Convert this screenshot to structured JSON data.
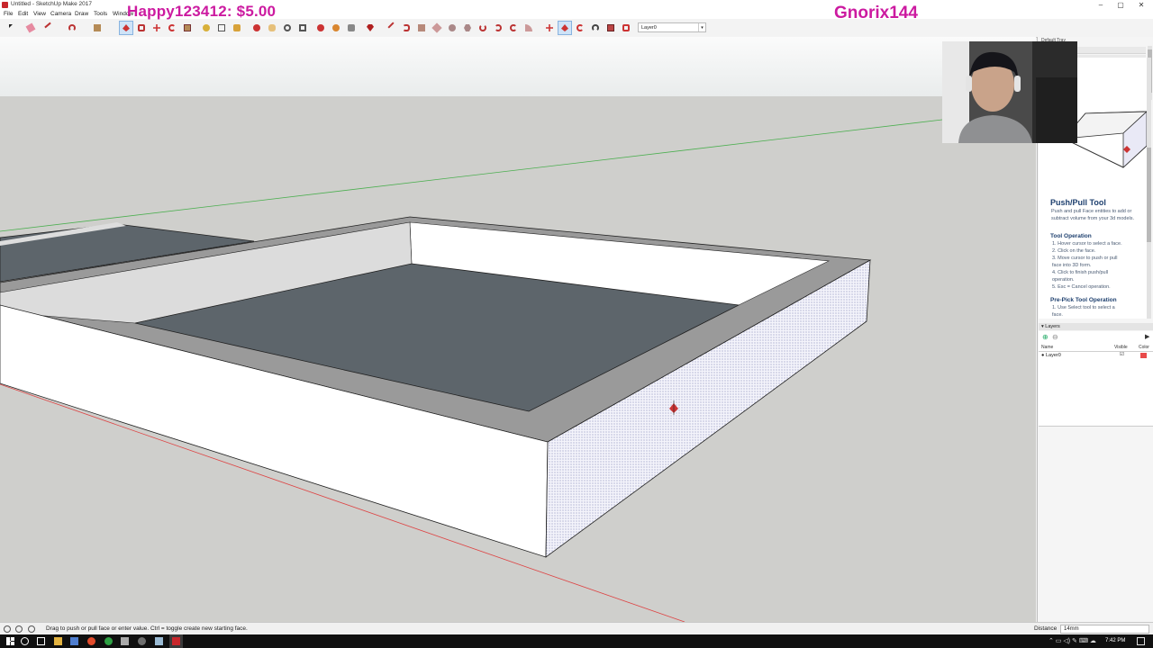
{
  "window": {
    "title": "Untitled - SketchUp Make 2017",
    "controls": {
      "minimize": "–",
      "maximize": "▢",
      "close": "✕"
    }
  },
  "menu": [
    "File",
    "Edit",
    "View",
    "Camera",
    "Draw",
    "Tools",
    "Window"
  ],
  "toolbar": {
    "layer_dropdown": "Layer0",
    "icons": [
      "select-icon",
      "eraser-icon",
      "line-icon",
      "arc-icon",
      "rectangle-icon",
      "push-pull-icon",
      "offset-icon",
      "move-icon",
      "rotate-icon",
      "scale-icon",
      "tape-measure-icon",
      "text-icon",
      "paint-bucket-icon",
      "orbit-icon",
      "pan-icon",
      "zoom-icon",
      "zoom-extents-icon"
    ],
    "active": "push-pull-icon"
  },
  "stream_overlay": {
    "donation": "Happy123412: $5.00",
    "username": "Gnorix144"
  },
  "tray": {
    "title": "Default Tray",
    "instructor": {
      "tool_name": "Push/Pull Tool",
      "description": "Push and pull Face entities to add or subtract volume from your 3d models.",
      "operation_heading": "Tool Operation",
      "operation_steps": [
        "1.  Hover cursor to select a face.",
        "2.  Click on the face.",
        "3.  Move cursor to push or pull",
        "     face into 3D form.",
        "4.  Click to finish push/pull",
        "     operation.",
        "5.  Esc = Cancel operation."
      ],
      "prepick_heading": "Pre-Pick Tool Operation",
      "prepick_steps": [
        "1.  Use Select tool to select a",
        "     face."
      ]
    },
    "layers": {
      "title": "Layers",
      "columns": {
        "name": "Name",
        "visible": "Visible",
        "color": "Color"
      },
      "rows": [
        {
          "name": "Layer0",
          "visible": "☑",
          "color": "#e84a4a"
        }
      ]
    }
  },
  "status": {
    "message": "Drag to push or pull face or enter value.  Ctrl = toggle create new starting face.",
    "distance_label": "Distance",
    "distance_value": "14mm"
  },
  "taskbar": {
    "clock": "7:42 PM"
  },
  "colors": {
    "sky_top": "#e9ecec",
    "ground": "#cfcfcc",
    "face_white": "#ffffff",
    "face_dark": "#5d656b",
    "rim": "#9a9a9a",
    "overlay_magenta": "#cc1aa0",
    "green_axis": "#4caf50",
    "red_axis": "#d44"
  }
}
